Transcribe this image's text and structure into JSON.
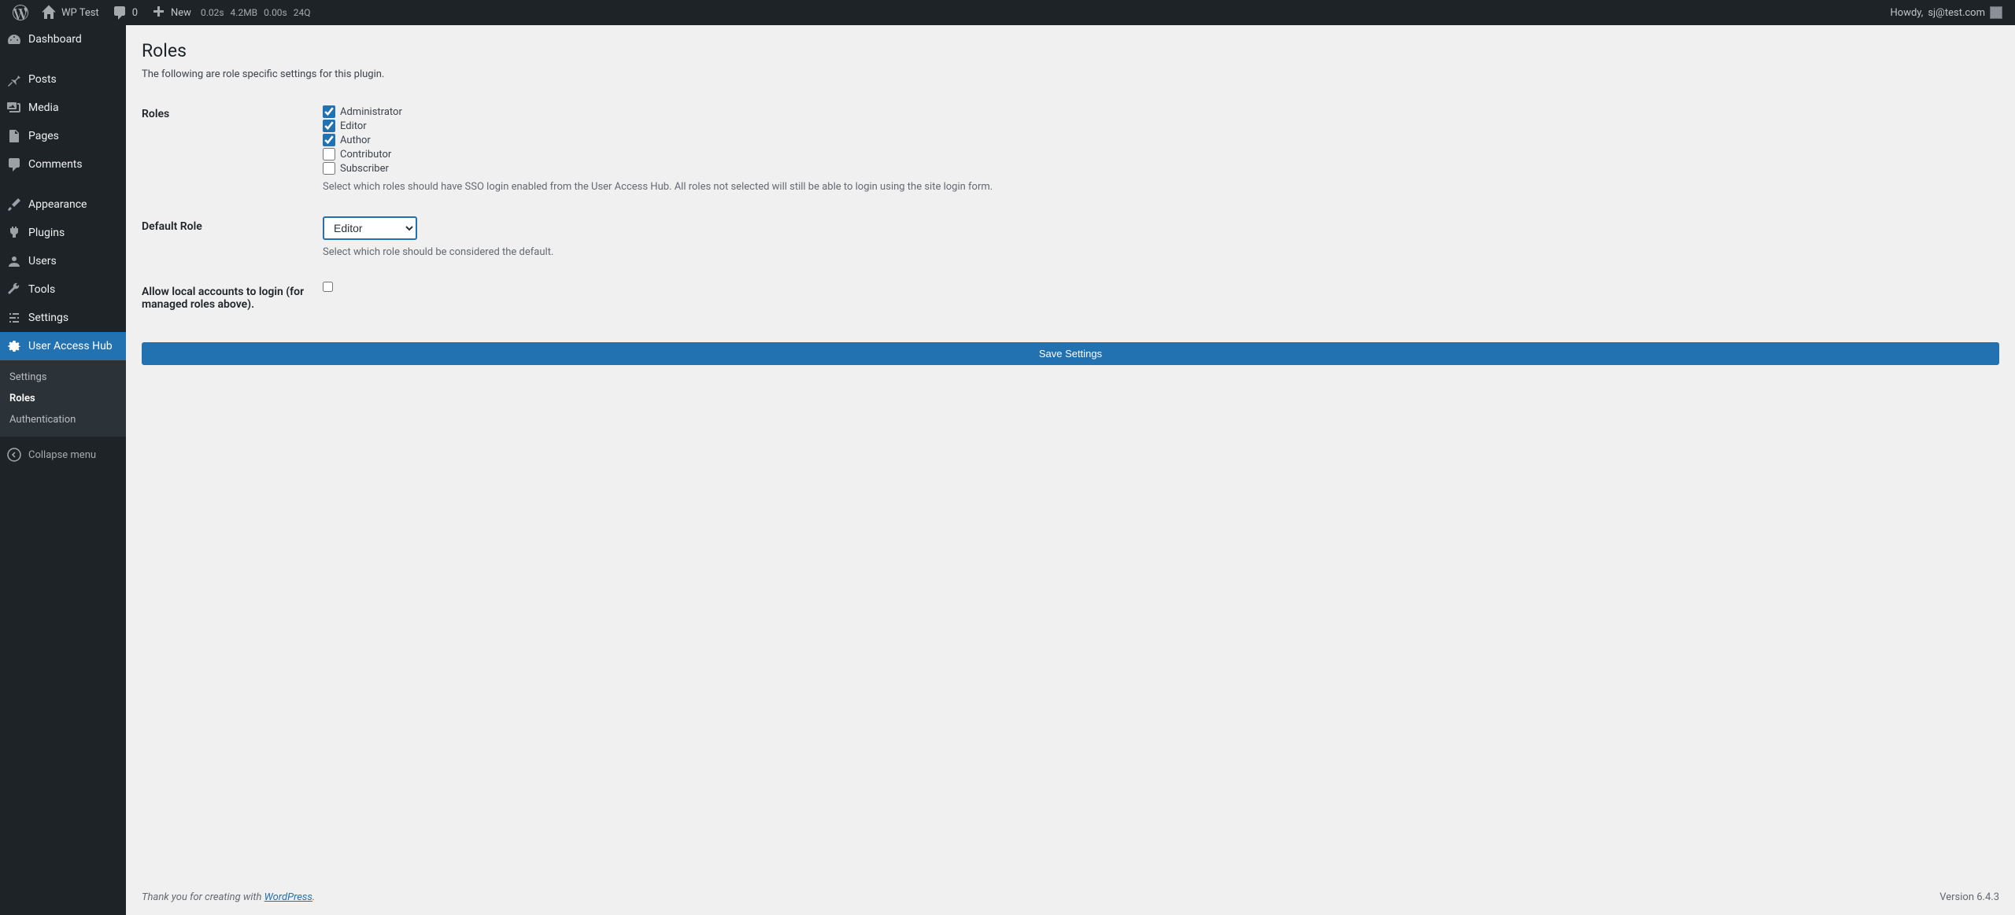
{
  "adminbar": {
    "site_name": "WP Test",
    "comments_count": "0",
    "new_label": "New",
    "stat_time1": "0.02s",
    "stat_mem": "4.2MB",
    "stat_time2": "0.00s",
    "stat_queries": "24Q",
    "howdy_prefix": "Howdy, ",
    "user_email": "sj@test.com"
  },
  "sidebar": {
    "items": [
      {
        "label": "Dashboard"
      },
      {
        "label": "Posts"
      },
      {
        "label": "Media"
      },
      {
        "label": "Pages"
      },
      {
        "label": "Comments"
      },
      {
        "label": "Appearance"
      },
      {
        "label": "Plugins"
      },
      {
        "label": "Users"
      },
      {
        "label": "Tools"
      },
      {
        "label": "Settings"
      },
      {
        "label": "User Access Hub"
      }
    ],
    "submenu": [
      {
        "label": "Settings"
      },
      {
        "label": "Roles"
      },
      {
        "label": "Authentication"
      }
    ],
    "collapse": "Collapse menu"
  },
  "page": {
    "title": "Roles",
    "intro": "The following are role specific settings for this plugin.",
    "roles_label": "Roles",
    "roles": [
      {
        "label": "Administrator",
        "checked": true
      },
      {
        "label": "Editor",
        "checked": true
      },
      {
        "label": "Author",
        "checked": true
      },
      {
        "label": "Contributor",
        "checked": false
      },
      {
        "label": "Subscriber",
        "checked": false
      }
    ],
    "roles_help": "Select which roles should have SSO login enabled from the User Access Hub. All roles not selected will still be able to login using the site login form.",
    "default_role_label": "Default Role",
    "default_role_value": "Editor",
    "default_role_help": "Select which role should be considered the default.",
    "allow_local_label": "Allow local accounts to login (for managed roles above).",
    "allow_local_checked": false,
    "save_button": "Save Settings"
  },
  "footer": {
    "thank_prefix": "Thank you for creating with ",
    "wp_link": "WordPress",
    "thank_suffix": ".",
    "version": "Version 6.4.3"
  }
}
